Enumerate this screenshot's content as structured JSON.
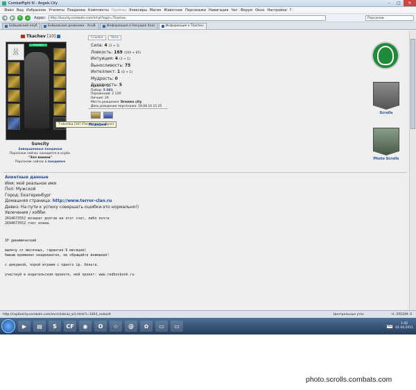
{
  "window": {
    "title": "CombatFight III - Angels City"
  },
  "menu": [
    "Файл",
    "Вид",
    "Избранное",
    "Утилиты",
    "Поединки",
    "Комплекты",
    "Приёмы",
    "Эликсиры",
    "Магия",
    "Животное",
    "Персонажи",
    "Навигация",
    "Чат",
    "Форум",
    "Окно",
    "Настройки",
    "?"
  ],
  "address": {
    "label": "Адрес:",
    "url": "http://tuncity.combats.com/inf.pl?login=Tkachev",
    "search_placeholder": "Персонаж"
  },
  "tabs": [
    "Бойцовский клуб",
    "Бойцовские дневники - AnuB.",
    "Информация о Несущая Хаос",
    "Информация о Tkachev"
  ],
  "character": {
    "name": "Tkachev",
    "level": "[10]",
    "hp": "27/1317",
    "tooltip": "T-elochka [10] (Посмотреть образ)",
    "location": "Suncity",
    "fights_done": "Завершенные поединки",
    "status1": "Персонаж сейчас находится в клубе.",
    "room": "\"Зал воинов\"",
    "status2": "Персонаж сейчас в",
    "status2_link": "поединке"
  },
  "buttons": {
    "link": "Ссылка",
    "logs": "Логи"
  },
  "stats": [
    {
      "label": "Сила:",
      "value": "4",
      "extra": "(3 + 1)"
    },
    {
      "label": "Ловкость:",
      "value": "169",
      "extra": "(104 + 65)"
    },
    {
      "label": "Интуиция:",
      "value": "4",
      "extra": "(3 + 1)"
    },
    {
      "label": "Выносливость:",
      "value": "75",
      "extra": ""
    },
    {
      "label": "Интеллект:",
      "value": "1",
      "extra": "(0 + 1)"
    },
    {
      "label": "Мудрость:",
      "value": "0",
      "extra": ""
    },
    {
      "label": "Духовность:",
      "value": "5",
      "extra": ""
    }
  ],
  "bio": {
    "level": "Уровень: 10",
    "wins_label": "Побед:",
    "wins": "5 081",
    "losses": "Поражений: 2 120",
    "draws": "Ничьих: 24",
    "birthplace_label": "Место рождения:",
    "birthplace": "Dreams city",
    "birthday": "День рождения персонажа: 18.08.10 21:25"
  },
  "gifts_label": "Подарки",
  "anketa": {
    "title": "Анкетные данные",
    "name": "Имя: моё реальное имя",
    "sex": "Пол: Мужской",
    "city": "Город: Екатеринбург",
    "homepage_label": "Домашняя страница:",
    "homepage": "http://www.terror-clan.ru",
    "motto": "Девиз: На пути к успеху совершать ошибки-это нормально!)",
    "hobbies": "Увлечения / хобби:",
    "lines": [
      "2614673552  возврат долгов на этот счет, либо почта",
      "2694673552 счет клана."
    ],
    "lines2": [
      "IP динамический",
      "",
      "вылечу от месячных, гарантия 9 месяцев)",
      "бываю временно неадекватен, не обращайте внимания!",
      "",
      "с девушкой, порой играем с одного ip.  Хельга.",
      "",
      "участвуй в издательском проекте, мой проект: www.redboxbook.ru"
    ]
  },
  "right_panel": {
    "scrolls": "Scrolls",
    "photo_scrolls": "Photo Scrolls"
  },
  "statusbar": {
    "url": "http://capitalcity.combats.com/encicl/obraz_w1.html?l=1004_rodazdt",
    "zone": "Центральные утес",
    "count": "Н: 2053/М: 0"
  },
  "taskbar": {
    "lang": "RU",
    "time": "1:42",
    "date": "01.04.2011"
  },
  "watermark": "photo.scrolls.combats.com"
}
